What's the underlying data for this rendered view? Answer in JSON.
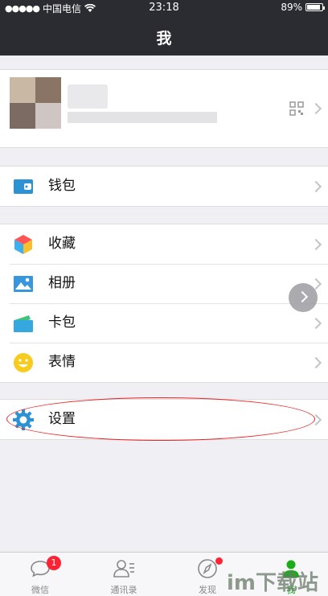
{
  "status_bar": {
    "signal": "●●●●●",
    "carrier": "中国电信",
    "time": "23:18",
    "battery": "89%",
    "battery_level": 0.89
  },
  "header": {
    "title": "我"
  },
  "menu": {
    "wallet": "钱包",
    "favorites": "收藏",
    "album": "相册",
    "cards": "卡包",
    "stickers": "表情",
    "settings": "设置"
  },
  "tabbar": {
    "chats": {
      "label": "微信",
      "badge": "1"
    },
    "contacts": {
      "label": "通讯录"
    },
    "discover": {
      "label": "发现"
    },
    "me": {
      "label": "我"
    }
  },
  "watermark": "im下载站",
  "colors": {
    "header_bg": "#2b2c31",
    "wechat_green": "#1aad19",
    "badge_red": "#ff2233",
    "annotation_red": "#ee2222"
  }
}
